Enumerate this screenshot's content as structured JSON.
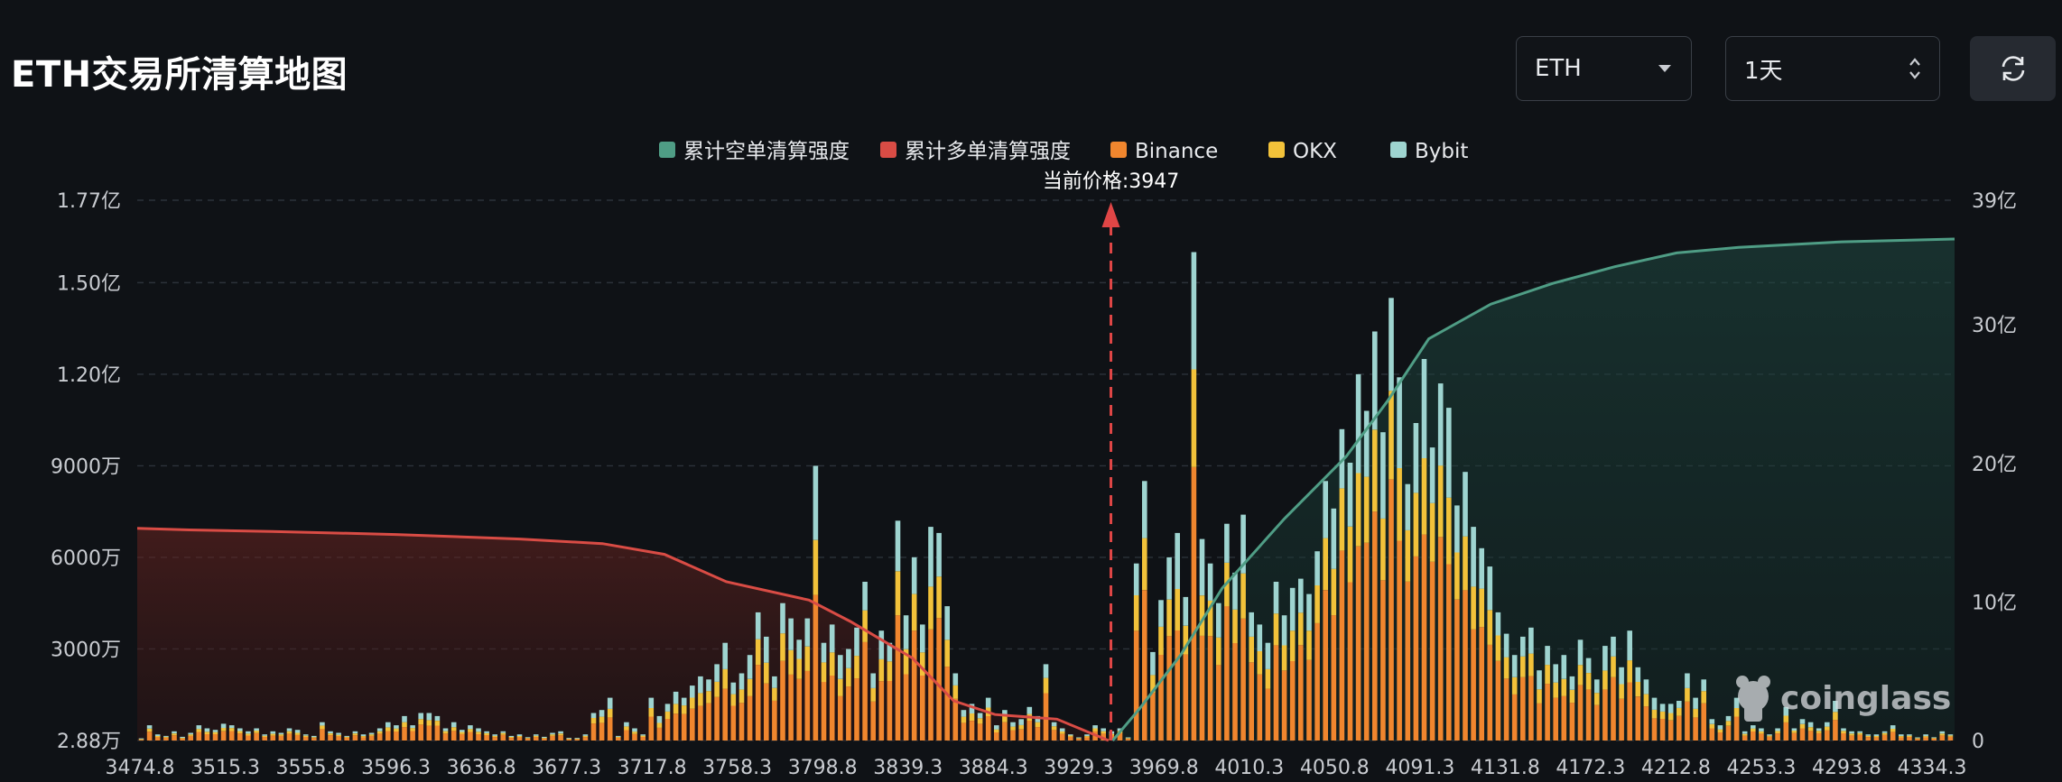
{
  "header": {
    "title": "ETH交易所清算地图",
    "coin_select": {
      "value": "ETH"
    },
    "range_select": {
      "value": "1天"
    }
  },
  "colors": {
    "background": "#0f1216",
    "short_cum": "#4f9d85",
    "long_cum": "#d94c45",
    "binance": "#f0862e",
    "okx": "#f2c23a",
    "bybit": "#9ed4d0",
    "current_price_line": "#e04646"
  },
  "icons": {
    "refresh": "refresh-icon",
    "dropdown": "caret-down-icon",
    "stepper": "updown-icon",
    "logo": "coinglass-logo-icon"
  },
  "watermark": "coinglass",
  "chart_data": {
    "type": "bar",
    "legend": [
      "累计空单清算强度",
      "累计多单清算强度",
      "Binance",
      "OKX",
      "Bybit"
    ],
    "legend_position": "top-center",
    "current_price_label": "当前价格:3947",
    "current_price": 3947,
    "x_tick_labels": [
      "3474.8",
      "3515.3",
      "3555.8",
      "3596.3",
      "3636.8",
      "3677.3",
      "3717.8",
      "3758.3",
      "3798.8",
      "3839.3",
      "3884.3",
      "3929.3",
      "3969.8",
      "4010.3",
      "4050.8",
      "4091.3",
      "4131.8",
      "4172.3",
      "4212.8",
      "4253.3",
      "4293.8",
      "4334.3"
    ],
    "y_left_tick_labels": [
      "2.88万",
      "3000万",
      "6000万",
      "9000万",
      "1.20亿",
      "1.50亿",
      "1.77亿"
    ],
    "y_left_tick_values": [
      28800,
      30000000,
      60000000,
      90000000,
      120000000,
      150000000,
      177000000
    ],
    "y_left_range": [
      0,
      177000000
    ],
    "y_right_tick_labels": [
      "0",
      "10亿",
      "20亿",
      "30亿",
      "39亿"
    ],
    "y_right_tick_values": [
      0,
      1000000000,
      2000000000,
      3000000000,
      3900000000
    ],
    "y_right_range": [
      0,
      3900000000
    ],
    "grid": "horizontal dashed",
    "bars_x_range": [
      3474.8,
      4354.5
    ],
    "bars_total_millions": [
      0.05,
      5,
      2,
      1.5,
      3,
      1.2,
      2.5,
      5,
      4,
      3.5,
      5.5,
      5,
      4,
      3,
      4,
      2,
      3,
      2.5,
      4,
      3.5,
      2,
      1.5,
      6,
      3,
      2.5,
      1.5,
      3,
      2,
      2.5,
      4,
      6,
      5,
      8,
      5,
      9,
      9,
      8,
      4,
      6,
      3.5,
      5,
      4,
      3,
      2,
      3,
      1.5,
      2,
      1,
      2,
      1.2,
      2.5,
      3,
      0.8,
      0.7,
      2,
      9,
      10,
      14,
      1.5,
      6,
      4,
      2,
      14,
      8,
      12,
      16,
      14,
      18,
      21,
      20,
      25,
      32,
      19,
      22,
      28,
      42,
      34,
      21,
      45,
      40,
      33,
      40,
      90,
      32,
      38,
      28,
      30,
      37,
      52,
      22,
      36,
      32,
      72,
      41,
      60,
      38,
      70,
      68,
      44,
      22,
      10,
      12,
      9,
      14,
      5,
      10,
      6,
      7,
      11,
      8,
      25,
      6,
      4,
      2,
      1,
      2,
      5,
      4,
      3,
      4,
      1,
      58,
      85,
      29,
      46,
      60,
      68,
      47,
      160,
      66,
      58,
      45,
      71,
      55,
      74,
      42,
      38,
      32,
      52,
      41,
      50,
      53,
      48,
      62,
      85,
      76,
      102,
      91,
      120,
      108,
      134,
      101,
      145,
      119,
      84,
      104,
      125,
      96,
      117,
      109,
      77,
      88,
      70,
      63,
      57,
      42,
      35,
      28,
      34,
      37,
      23,
      31,
      25,
      28,
      21,
      33,
      27,
      20,
      31,
      34,
      24,
      36,
      24,
      20,
      14,
      12,
      12,
      13,
      22,
      14,
      20,
      7,
      5,
      8,
      14,
      3,
      5,
      4,
      2,
      4,
      11,
      4,
      7,
      6,
      4,
      6,
      13,
      4,
      3,
      3,
      2,
      2,
      3,
      5,
      2,
      2,
      1,
      2,
      1,
      3,
      2
    ],
    "bars_binance_share": 0.62,
    "bars_okx_share": 0.2,
    "long_cum_points": [
      [
        3474.8,
        69500000.0
      ],
      [
        3500,
        69000000.0
      ],
      [
        3540,
        68500000.0
      ],
      [
        3600,
        67500000.0
      ],
      [
        3660,
        66000000.0
      ],
      [
        3700,
        64500000.0
      ],
      [
        3730,
        61000000.0
      ],
      [
        3760,
        52000000.0
      ],
      [
        3800,
        46000000.0
      ],
      [
        3820,
        39000000.0
      ],
      [
        3850,
        27000000.0
      ],
      [
        3870,
        13000000.0
      ],
      [
        3890,
        8500000.0
      ],
      [
        3920,
        7000000.0
      ],
      [
        3945,
        0
      ]
    ],
    "short_cum_points": [
      [
        3947,
        0
      ],
      [
        3960,
        230000000.0
      ],
      [
        3980,
        620000000.0
      ],
      [
        4000,
        1100000000.0
      ],
      [
        4030,
        1600000000.0
      ],
      [
        4060,
        2050000000.0
      ],
      [
        4080,
        2450000000.0
      ],
      [
        4100,
        2900000000.0
      ],
      [
        4130,
        3150000000.0
      ],
      [
        4160,
        3300000000.0
      ],
      [
        4190,
        3420000000.0
      ],
      [
        4220,
        3520000000.0
      ],
      [
        4250,
        3560000000.0
      ],
      [
        4300,
        3600000000.0
      ],
      [
        4354.5,
        3620000000.0
      ]
    ]
  }
}
